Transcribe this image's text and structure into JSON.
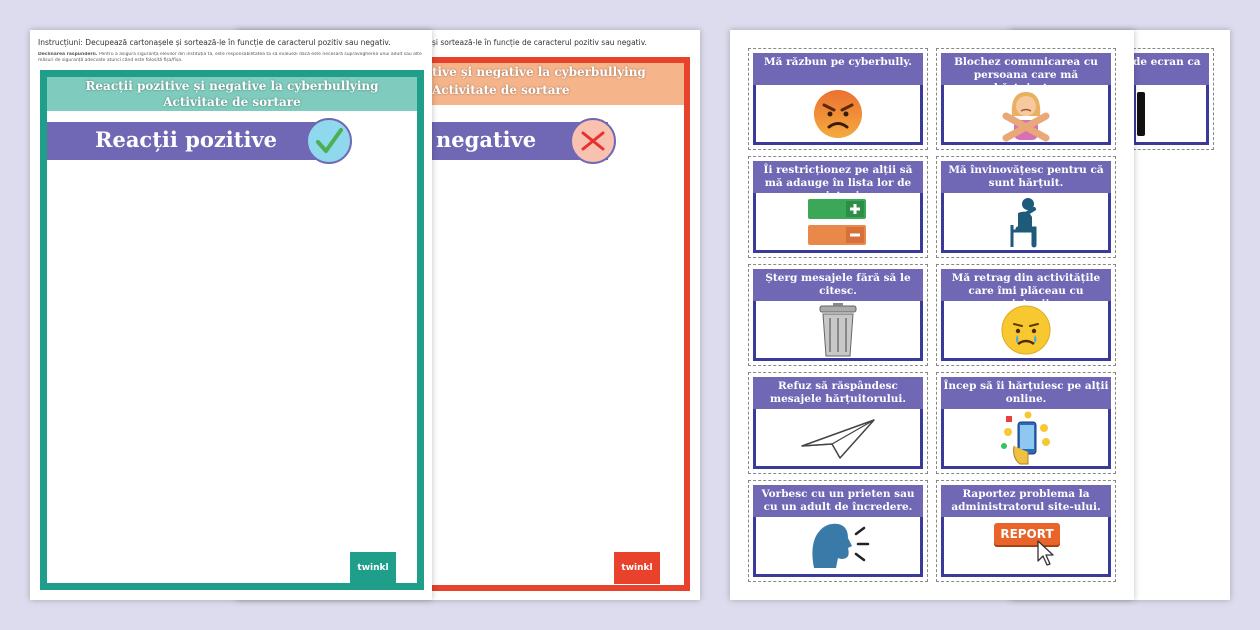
{
  "left_sheets": {
    "instructions": "Instrucțiuni: Decupează cartonașele și sortează-le în funcție de caracterul pozitiv sau negativ.",
    "instructions_back": "și sortează-le în funcție de caracterul pozitiv sau negativ.",
    "disclaimer_title": "Declinarea răspunderii.",
    "disclaimer_text": "Pentru a asigura siguranța elevilor din instituția ta, este responsabilitatea ta să evaluezi dacă este necesară supravegherea unui adult sau alte măsuri de siguranță adecvate atunci când este folosită fișa/fișa.",
    "header_line1": "Reacții pozitive și negative la cyberbullying",
    "header_line2": "Activitate de sortare",
    "header_line1_back": "tive și negative la cyberbullying",
    "header_line2_back": "Activitate de sortare",
    "positive_title": "Reacții pozitive",
    "negative_title": "negative",
    "logo": "twinkl",
    "colors": {
      "teal": "#1f9e8a",
      "teal_light": "#7fcbbd",
      "red": "#e8412c",
      "peach": "#f5b48a",
      "purple": "#7068b4"
    }
  },
  "cards": [
    {
      "text": "Mă răzbun pe cyberbully.",
      "icon": "angry-face-icon"
    },
    {
      "text": "Blochez comunicarea cu persoana care mă hărțuiește.",
      "icon": "girl-blocking-icon"
    },
    {
      "text": "Îi restricționez pe alții să mă adauge în lista lor de prieteni.",
      "icon": "add-remove-icon"
    },
    {
      "text": "Mă învinovățesc pentru că sunt hărțuit.",
      "icon": "sad-person-icon"
    },
    {
      "text": "Șterg mesajele fără să le citesc.",
      "icon": "trash-bin-icon"
    },
    {
      "text": "Mă retrag din activitățile care îmi plăceau cu prietenii.",
      "icon": "crying-face-icon"
    },
    {
      "text": "Refuz să răspândesc mesajele hărțuitorului.",
      "icon": "paper-plane-icon"
    },
    {
      "text": "Încep să îi hărțuiesc pe alții online.",
      "icon": "phone-emoji-icon"
    },
    {
      "text": "Vorbesc cu un prieten sau cu un adult de încredere.",
      "icon": "speaking-head-icon"
    },
    {
      "text": "Raportez problema la administratorul site-ului.",
      "icon": "report-button-icon"
    }
  ],
  "back_card_text": "de ecran ca",
  "report_label": "REPORT"
}
